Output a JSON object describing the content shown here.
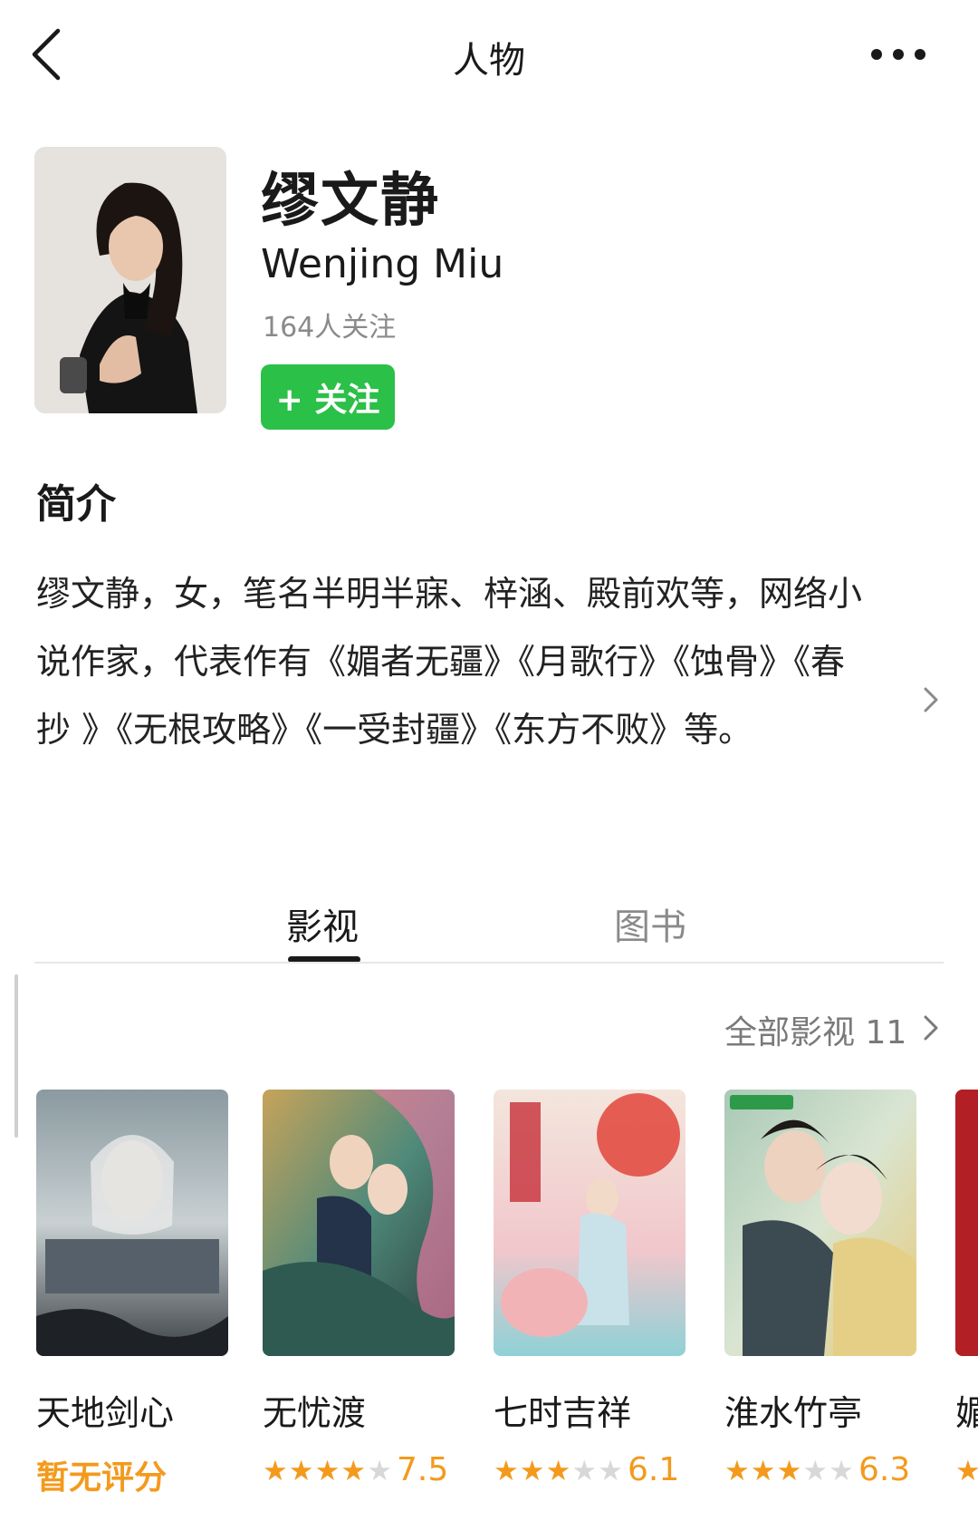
{
  "header": {
    "title": "人物",
    "back_icon": "chevron-left-icon",
    "more_icon": "more-dots-icon"
  },
  "profile": {
    "name_cn": "缪文静",
    "name_en": "Wenjing Miu",
    "followers": "164人关注",
    "follow_button": "+ 关注",
    "follow_color": "#2bc048"
  },
  "intro": {
    "heading": "简介",
    "text": "缪文静，女，笔名半明半寐、梓涵、殿前欢等，网络小说作家，代表作有《媚者无疆》《月歌行》《蚀骨》《春抄 》《无根攻略》《一受封疆》《东方不败》等。"
  },
  "tabs": [
    {
      "label": "影视",
      "active": true
    },
    {
      "label": "图书",
      "active": false
    }
  ],
  "films": {
    "all_link": "全部影视 11",
    "accent": "#f39a1d",
    "items": [
      {
        "title": "天地剑心",
        "rating_text": "暂无评分",
        "stars": 0,
        "score": ""
      },
      {
        "title": "无忧渡",
        "rating_text": "",
        "stars": 4,
        "score": "7.5"
      },
      {
        "title": "七时吉祥",
        "rating_text": "",
        "stars": 3,
        "score": "6.1"
      },
      {
        "title": "淮水竹亭",
        "rating_text": "",
        "stars": 3,
        "score": "6.3"
      },
      {
        "title": "媚",
        "rating_text": "",
        "stars": 1,
        "score": ""
      }
    ]
  }
}
